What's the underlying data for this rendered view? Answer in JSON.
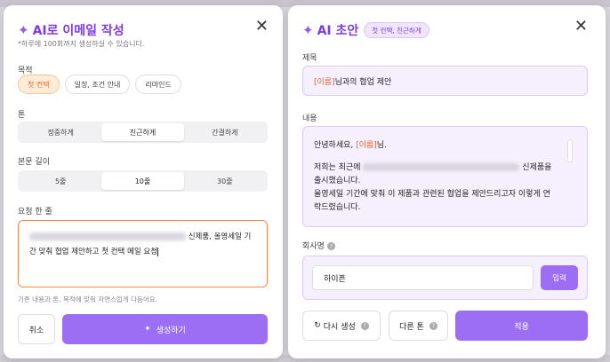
{
  "left": {
    "title": "AI로 이메일 작성",
    "close": "✕",
    "subtitle": "*하루에 100회까지 생성하실 수 있습니다.",
    "purpose": {
      "label": "목적",
      "options": [
        "첫 컨택",
        "일정, 조건 안내",
        "리마인드"
      ],
      "selected": "첫 컨택"
    },
    "tone": {
      "label": "톤",
      "options": [
        "정중하게",
        "친근하게",
        "간결하게"
      ],
      "selected": "친근하게"
    },
    "length": {
      "label": "본문 길이",
      "options": [
        "5줄",
        "10줄",
        "30줄"
      ],
      "selected": "10줄"
    },
    "request": {
      "label": "요청 한 줄",
      "line1_suffix": "신제품, 올영세일 기",
      "line2": "간 맞춰 협업 제안하고 첫 컨택 메일 요청"
    },
    "hint": "기존 내용과 톤, 목적에 맞춰 자연스럽게 다듬어요.",
    "cancel_label": "취소",
    "generate_label": "생성하기"
  },
  "right": {
    "title": "AI 초안",
    "badge": "첫 컨택, 친근하게",
    "close": "✕",
    "subject": {
      "label": "제목",
      "placeholder_token": "[이름]",
      "suffix": "님과의 협업 제안"
    },
    "body": {
      "label": "내용",
      "greeting_prefix": "안녕하세요, ",
      "greeting_token": "[이름]",
      "greeting_suffix": "님.",
      "line2_prefix": "저희는 최근에",
      "line2_suffix": "신제품을",
      "line3": "출시했습니다.",
      "line4": "올영세일 기간에 맞춰 이 제품과 관련된 협업을 제안드리고자 이렇게 연",
      "line5": "락드렸습니다."
    },
    "company": {
      "label": "회사명",
      "help": "?",
      "value": "하이픈",
      "enter_label": "입력"
    },
    "regenerate_label": "다시 생성",
    "other_tone_label": "다른 톤",
    "help": "?",
    "apply_label": "적용"
  }
}
